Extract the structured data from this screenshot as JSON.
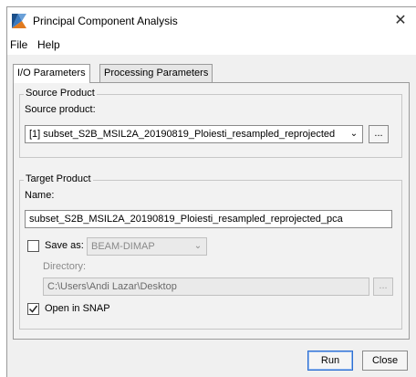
{
  "window": {
    "title": "Principal Component Analysis"
  },
  "menu": {
    "items": [
      "File",
      "Help"
    ]
  },
  "tabs": [
    "I/O Parameters",
    "Processing Parameters"
  ],
  "source": {
    "group_title": "Source Product",
    "label": "Source product:",
    "selected": "[1] subset_S2B_MSIL2A_20190819_Ploiesti_resampled_reprojected",
    "browse_label": "..."
  },
  "target": {
    "group_title": "Target Product",
    "name_label": "Name:",
    "name_value": "subset_S2B_MSIL2A_20190819_Ploiesti_resampled_reprojected_pca",
    "save_as_label": "Save as:",
    "save_as_checked": false,
    "format_value": "BEAM-DIMAP",
    "directory_label": "Directory:",
    "directory_value": "C:\\Users\\Andi Lazar\\Desktop",
    "browse_label": "...",
    "open_in_snap_label": "Open in SNAP",
    "open_in_snap_checked": true
  },
  "buttons": {
    "run": "Run",
    "close": "Close"
  }
}
